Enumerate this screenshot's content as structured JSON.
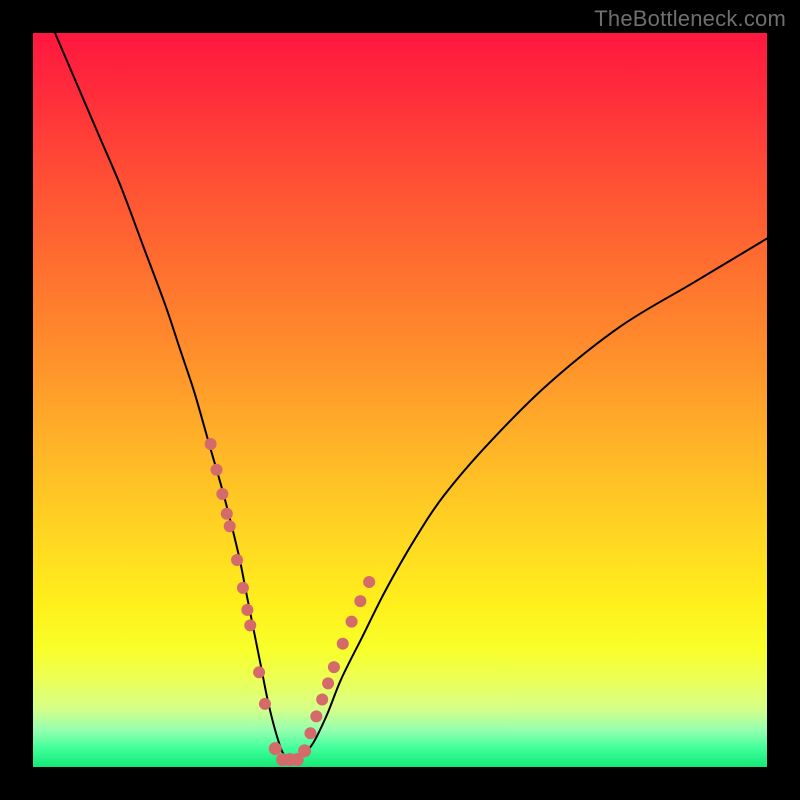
{
  "watermark": "TheBottleneck.com",
  "colors": {
    "background": "#000000",
    "gradient_top": "#ff173f",
    "gradient_bottom": "#14e874",
    "curve": "#000000",
    "dots": "#d46a6a"
  },
  "chart_data": {
    "type": "line",
    "title": "",
    "xlabel": "",
    "ylabel": "",
    "xlim": [
      0,
      100
    ],
    "ylim": [
      0,
      100
    ],
    "grid": false,
    "legend": false,
    "annotations": [
      "TheBottleneck.com"
    ],
    "series": [
      {
        "name": "bottleneck-curve",
        "x": [
          3,
          6,
          9,
          12,
          15,
          18,
          20,
          22,
          24,
          26,
          28,
          29,
          30,
          31,
          32,
          33,
          34,
          35,
          36,
          38,
          40,
          42,
          45,
          48,
          52,
          56,
          62,
          70,
          80,
          90,
          100
        ],
        "y": [
          100,
          93,
          86,
          79,
          71,
          63,
          57,
          51,
          44,
          37,
          29,
          24,
          19,
          14,
          9,
          5,
          2,
          1,
          1,
          3,
          7,
          12,
          18,
          24,
          31,
          37,
          44,
          52,
          60,
          66,
          72
        ]
      }
    ],
    "markers": [
      {
        "name": "highlight-dots",
        "x": [
          24.2,
          25.0,
          25.8,
          26.4,
          26.8,
          27.8,
          28.6,
          29.2,
          29.6,
          30.8,
          31.6,
          33.0,
          34.0,
          35.0,
          36.0,
          37.0,
          37.8,
          38.6,
          39.4,
          40.2,
          41.0,
          42.2,
          43.4,
          44.6,
          45.8
        ],
        "y": [
          44.0,
          40.5,
          37.2,
          34.5,
          32.8,
          28.2,
          24.4,
          21.4,
          19.3,
          12.9,
          8.6,
          2.5,
          1.0,
          1.0,
          1.0,
          2.2,
          4.6,
          6.9,
          9.2,
          11.4,
          13.6,
          16.8,
          19.8,
          22.6,
          25.2
        ]
      }
    ]
  }
}
